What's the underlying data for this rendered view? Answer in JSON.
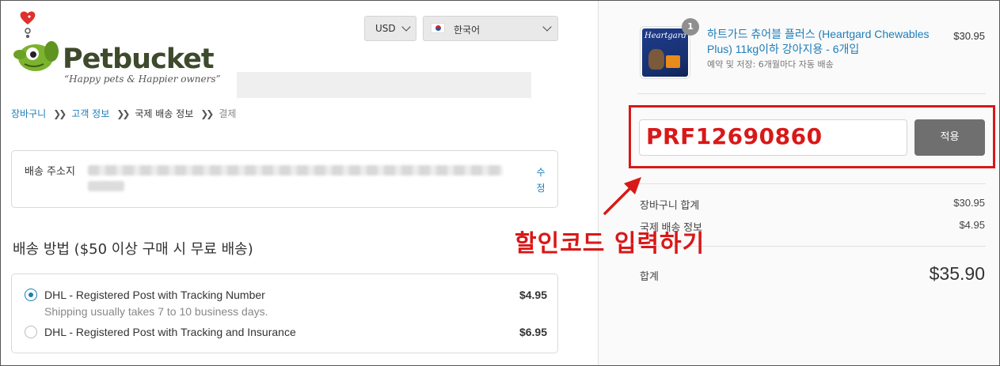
{
  "brand": {
    "name": "Petbucket",
    "tagline": "“Happy pets & Happier owners”"
  },
  "header": {
    "currency": "USD",
    "language": "한국어"
  },
  "breadcrumb": [
    {
      "label": "장바구니"
    },
    {
      "label": "고객 정보"
    },
    {
      "label": "국제 배송 정보"
    },
    {
      "label": "결제"
    }
  ],
  "address": {
    "label": "배송 주소지",
    "edit": "수정"
  },
  "shipping": {
    "title": "배송 방법 ($50 이상 구매 시 무료 배송)",
    "options": [
      {
        "name": "DHL - Registered Post with Tracking Number",
        "note": "Shipping usually takes 7 to 10 business days.",
        "price": "$4.95",
        "selected": true
      },
      {
        "name": "DHL - Registered Post with Tracking and Insurance",
        "price": "$6.95",
        "selected": false
      }
    ]
  },
  "cart": {
    "item": {
      "quantity": "1",
      "name": "하트가드 츄어블 플러스 (Heartgard Chewables Plus) 11kg이하 강아지용 - 6개입",
      "meta": "예약 및 저장: 6개월마다 자동 배송",
      "price": "$30.95",
      "package_brand": "Heartgard"
    },
    "coupon_value": "PRF12690860",
    "apply_label": "적용",
    "subtotal_label": "장바구니 합계",
    "subtotal": "$30.95",
    "shipping_label": "국제 배송 정보",
    "shipping": "$4.95",
    "total_label": "합계",
    "total": "$35.90"
  },
  "annotation": {
    "text": "할인코드 입력하기"
  },
  "colors": {
    "accent": "#1d7db8",
    "annotation_red": "#d91818",
    "button_gray": "#6f6f6f",
    "logo_green": "#7bb32e"
  }
}
